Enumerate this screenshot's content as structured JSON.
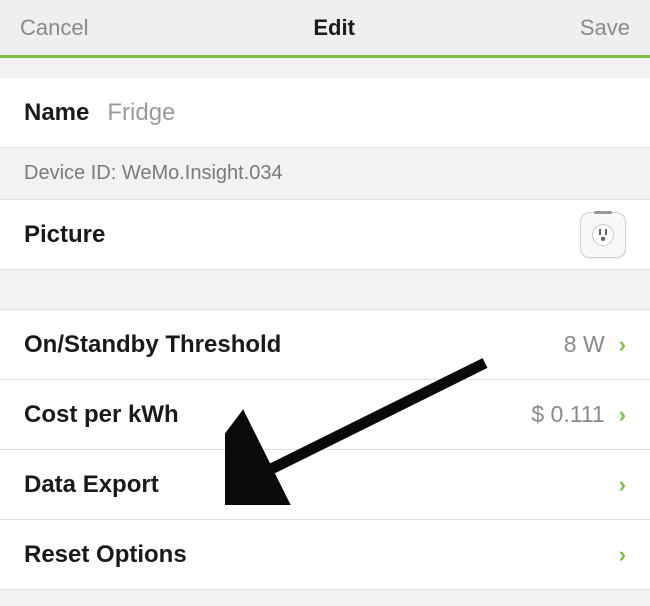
{
  "nav": {
    "cancel": "Cancel",
    "title": "Edit",
    "save": "Save"
  },
  "name_row": {
    "label": "Name",
    "value": "Fridge"
  },
  "device_id": {
    "label": "Device ID:",
    "value": "WeMo.Insight.034"
  },
  "picture_row": {
    "label": "Picture"
  },
  "threshold_row": {
    "label": "On/Standby Threshold",
    "value": "8 W"
  },
  "cost_row": {
    "label": "Cost per kWh",
    "value": "$ 0.111"
  },
  "data_export_row": {
    "label": "Data Export"
  },
  "reset_row": {
    "label": "Reset Options"
  },
  "colors": {
    "accent": "#7bc043"
  }
}
